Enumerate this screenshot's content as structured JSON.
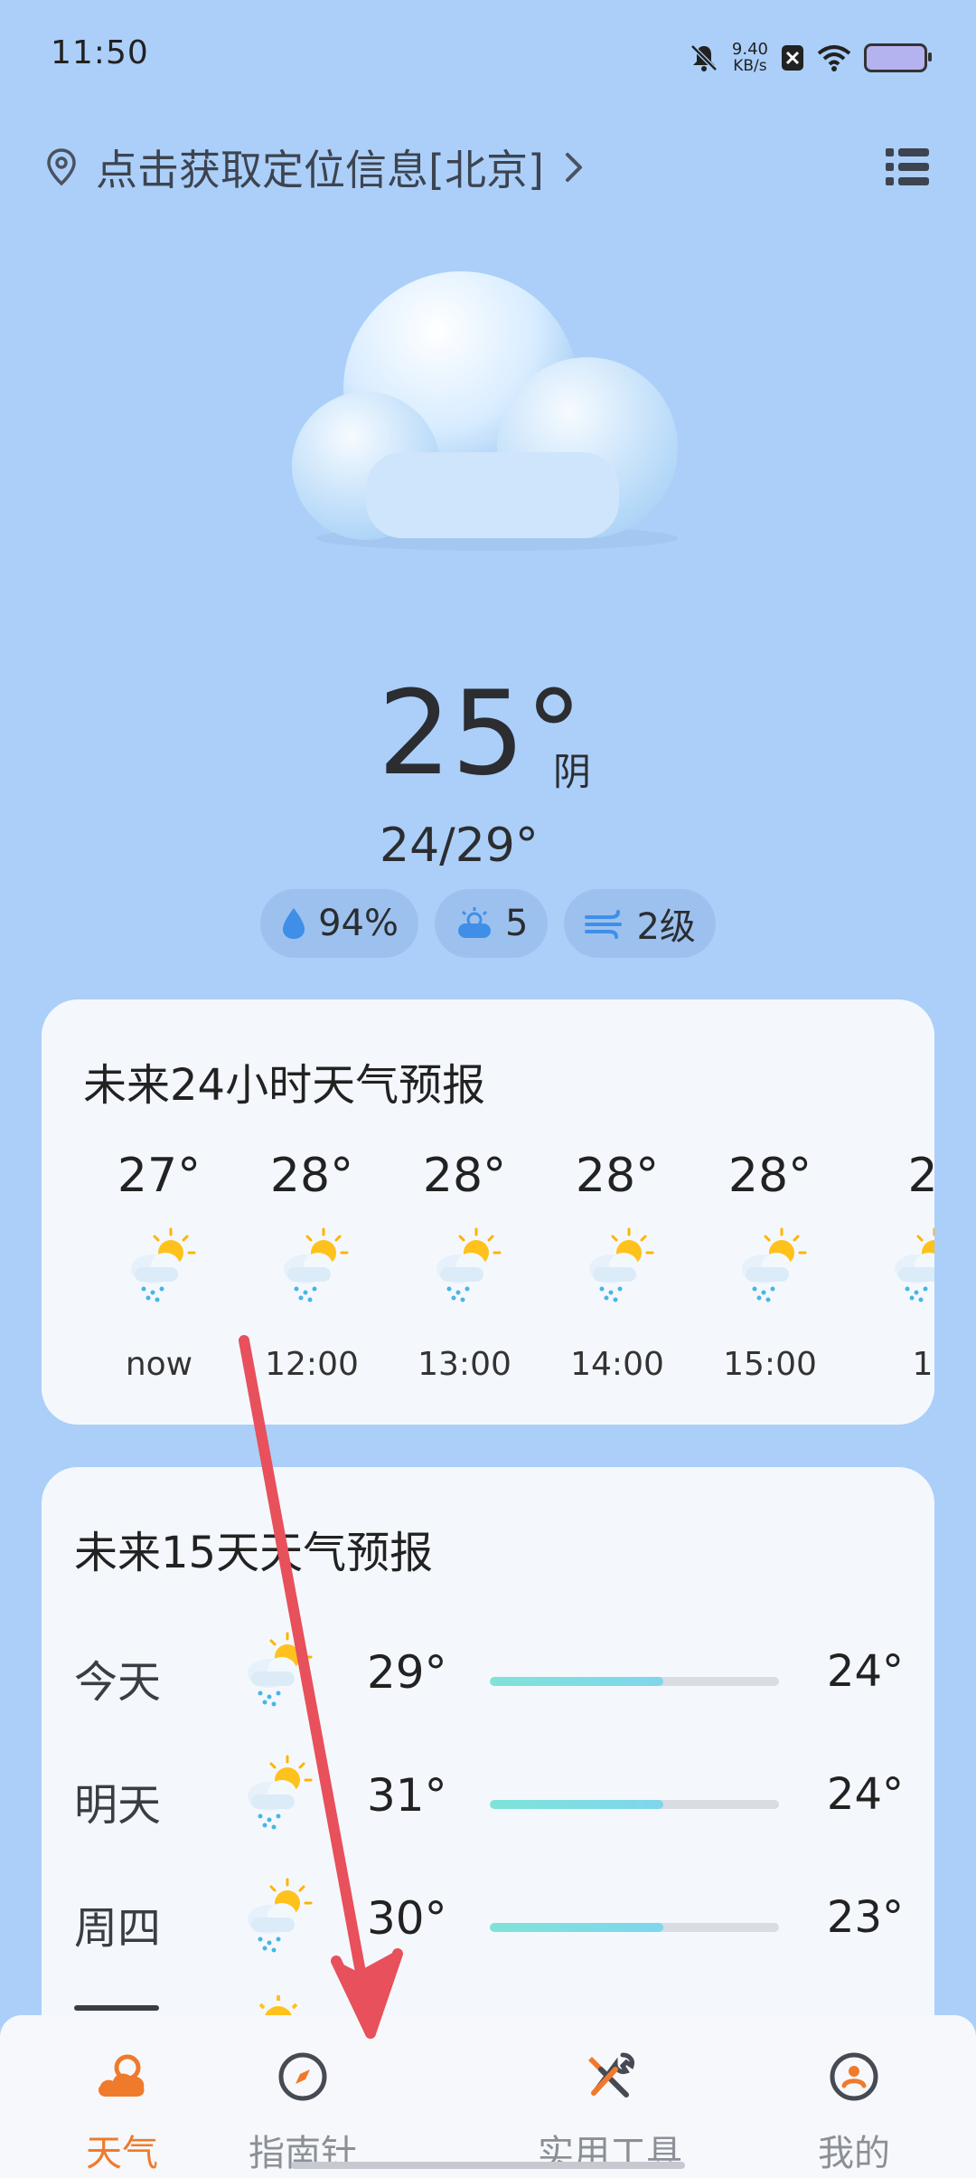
{
  "status_bar": {
    "time": "11:50",
    "net_speed_value": "9.40",
    "net_speed_unit": "KB/s"
  },
  "location": {
    "text": "点击获取定位信息[北京]",
    "icon": "location-pin-icon"
  },
  "current": {
    "temp": "25°",
    "condition": "阴",
    "range": "24/29°",
    "humidity": "94%",
    "aqi": "5",
    "wind": "2级"
  },
  "hourly": {
    "title": "未来24小时天气预报",
    "items": [
      {
        "temp": "27°",
        "label": "now",
        "icon": "sun-rain-cloud-icon"
      },
      {
        "temp": "28°",
        "label": "12:00",
        "icon": "sun-rain-cloud-icon"
      },
      {
        "temp": "28°",
        "label": "13:00",
        "icon": "sun-rain-cloud-icon"
      },
      {
        "temp": "28°",
        "label": "14:00",
        "icon": "sun-rain-cloud-icon"
      },
      {
        "temp": "28°",
        "label": "15:00",
        "icon": "sun-rain-cloud-icon"
      },
      {
        "temp": "2",
        "label": "1",
        "icon": "sun-rain-cloud-icon"
      }
    ]
  },
  "daily": {
    "title": "未来15天天气预报",
    "items": [
      {
        "day": "今天",
        "high": "29°",
        "low": "24°",
        "bar_fill": 0.6,
        "icon": "sun-rain-cloud-icon"
      },
      {
        "day": "明天",
        "high": "31°",
        "low": "24°",
        "bar_fill": 0.6,
        "icon": "sun-rain-cloud-icon"
      },
      {
        "day": "周四",
        "high": "30°",
        "low": "23°",
        "bar_fill": 0.6,
        "icon": "sun-rain-cloud-icon"
      }
    ]
  },
  "bottom_nav": {
    "items": [
      {
        "label": "天气",
        "icon": "weather-cloud-icon",
        "active": true
      },
      {
        "label": "指南针",
        "icon": "compass-icon",
        "active": false
      },
      {
        "label": "实用工具",
        "icon": "tools-icon",
        "active": false
      },
      {
        "label": "我的",
        "icon": "profile-icon",
        "active": false
      }
    ]
  },
  "colors": {
    "background": "#abcff9",
    "accent": "#f07a2b",
    "annotation_arrow": "#e8505b"
  }
}
